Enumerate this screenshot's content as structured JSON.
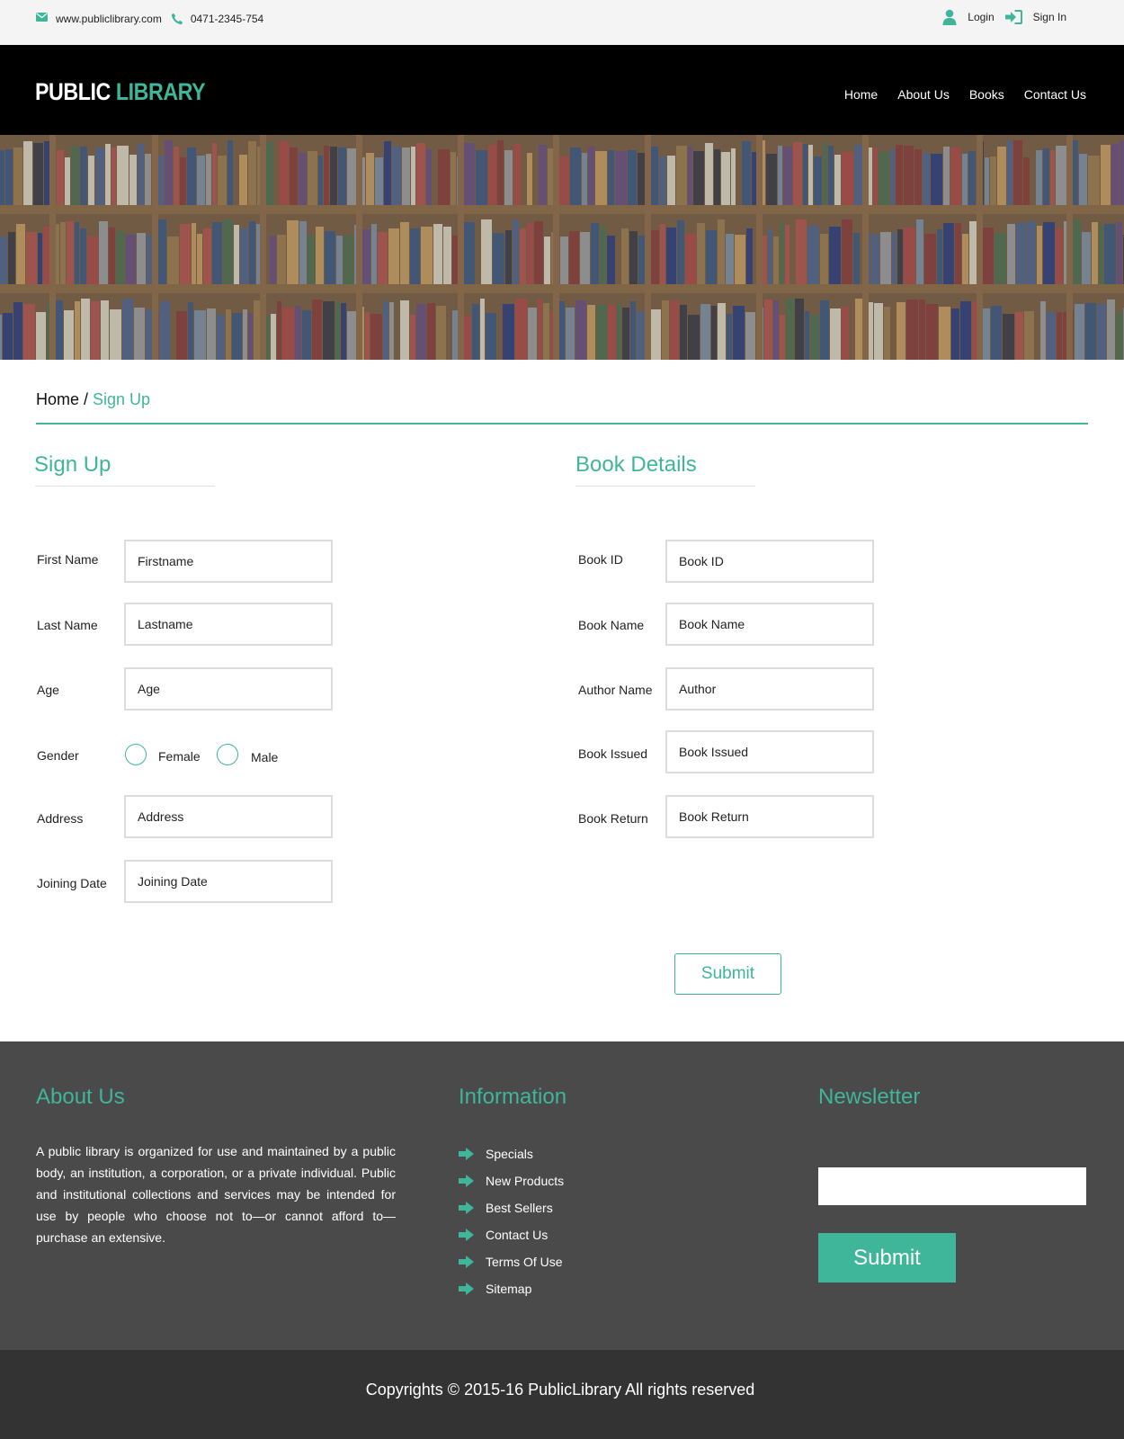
{
  "colors": {
    "accent": "#3fb59a",
    "header_bg": "#000000",
    "footer_bg": "#4a4a4a",
    "bottom_bg": "#333333",
    "topbar_bg": "#f4f4f4"
  },
  "topbar": {
    "website": "www.publiclibrary.com",
    "phone": "0471-2345-754",
    "website_icon": "envelope-icon",
    "phone_icon": "phone-icon",
    "login_label": "Login",
    "login_icon": "user-icon",
    "signin_label": "Sign In",
    "signin_icon": "sign-in-icon"
  },
  "header": {
    "logo_part1": "PUBLIC",
    "logo_part2": "LIBRARY",
    "nav": [
      "Home",
      "About Us",
      "Books",
      "Contact Us"
    ]
  },
  "breadcrumb": {
    "home": "Home",
    "separator": " / ",
    "current": "Sign Up"
  },
  "signup": {
    "title": "Sign Up",
    "first_name": {
      "label": "First Name",
      "placeholder": "Firstname"
    },
    "last_name": {
      "label": "Last Name",
      "placeholder": "Lastname"
    },
    "age": {
      "label": "Age",
      "placeholder": "Age"
    },
    "gender": {
      "label": "Gender",
      "options": [
        "Female",
        "Male"
      ]
    },
    "address": {
      "label": "Address",
      "placeholder": "Address"
    },
    "joining_date": {
      "label": "Joining Date",
      "placeholder": "Joining Date"
    }
  },
  "book_details": {
    "title": "Book Details",
    "book_id": {
      "label": "Book ID",
      "placeholder": "Book ID"
    },
    "book_name": {
      "label": "Book Name",
      "placeholder": "Book Name"
    },
    "author_name": {
      "label": "Author Name",
      "placeholder": "Author"
    },
    "book_issued": {
      "label": "Book Issued",
      "placeholder": "Book Issued"
    },
    "book_return": {
      "label": "Book Return",
      "placeholder": "Book Return"
    },
    "submit_label": "Submit"
  },
  "footer": {
    "about_title": "About Us",
    "about_text": "A public library is organized for use and maintained by a public body, an institution, a corporation, or a private individual. Public and institutional collections and services may be intended for use by people who choose not to—or cannot afford to—purchase an extensive.",
    "info_title": "Information",
    "info_links": [
      "Specials",
      "New Products",
      "Best Sellers",
      "Contact Us",
      "Terms Of Use",
      "Sitemap"
    ],
    "info_icon": "arrow-right-icon",
    "newsletter_title": "Newsletter",
    "newsletter_submit": "Submit"
  },
  "copyright": "Copyrights © 2015-16 PublicLibrary All rights reserved"
}
